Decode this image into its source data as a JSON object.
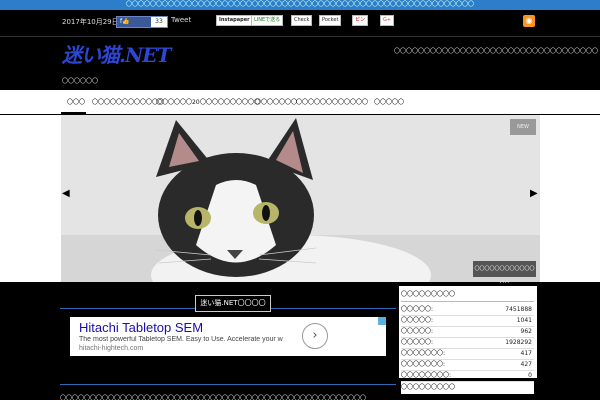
{
  "top_notice": {
    "first": "〇〇〇〇〇〇〇〇〇〇〇〇〇〇〇〇〇〇〇〇〇〇",
    "second": "〇〇〇〇〇〇〇〇〇〇〇〇〇〇〇〇〇〇〇〇〇〇〇〇〇〇〇〇〇〇〇〇〇〇〇〇"
  },
  "social": {
    "date": "2017年10月29日",
    "facebook_label": "f👍",
    "facebook_count": "33",
    "tweet_label": "Tweet",
    "buttons": [
      "Instapaper",
      "LINEで送る",
      "Check",
      "Pocket",
      "ピン",
      "G+"
    ]
  },
  "header": {
    "logo": "迷い猫.NET",
    "tagline": "〇〇〇〇〇〇",
    "right_text": "〇〇〇〇〇〇〇〇〇〇〇〇〇〇〇〇〇〇〇〇〇〇〇〇〇〇〇〇〇〇〇〇〇〇"
  },
  "nav": {
    "items": [
      "〇〇〇",
      "〇〇〇〇〇〇〇〇〇〇〇〇",
      "〇〇〇〇〇〇20",
      "〇〇〇〇〇〇〇〇〇〇",
      "〇〇〇〇〇〇〇",
      "〇〇〇〇〇〇〇",
      "〇〇〇〇〇",
      "〇〇〇〇〇"
    ]
  },
  "hero": {
    "tag": "NEW",
    "caption": "〇〇〇〇〇〇〇〇〇〇〇〇〇〇",
    "prev_arrow": "◀",
    "next_arrow": "▶"
  },
  "main": {
    "section_title": "迷い猫.NET〇〇〇〇",
    "bottom_text": "〇〇〇〇〇〇〇〇〇〇〇〇〇〇〇〇〇〇〇〇〇〇〇〇〇〇〇〇〇〇〇〇〇〇〇〇〇〇〇〇〇〇〇〇〇〇〇〇〇〇〇"
  },
  "ad": {
    "title": "Hitachi Tabletop SEM",
    "subtitle": "The most powerful Tabletop SEM. Easy to Use. Accelerate your w",
    "url": "hitachi-hightech.com",
    "button": "›"
  },
  "sidebar": {
    "heading": "〇〇〇〇〇〇〇〇〇",
    "stats": [
      {
        "label": "〇〇〇〇〇:",
        "value": "7451888"
      },
      {
        "label": "〇〇〇〇〇:",
        "value": "1041"
      },
      {
        "label": "〇〇〇〇〇:",
        "value": "962"
      },
      {
        "label": "〇〇〇〇〇:",
        "value": "1928292"
      },
      {
        "label": "〇〇〇〇〇〇〇:",
        "value": "417"
      },
      {
        "label": "〇〇〇〇〇〇〇:",
        "value": "427"
      },
      {
        "label": "〇〇〇〇〇〇〇〇:",
        "value": "0"
      }
    ],
    "heading2": "〇〇〇〇〇〇〇〇〇"
  },
  "colors": {
    "logo": "#2d46d4",
    "accent_blue": "#2c7ec9",
    "rss": "#f79422"
  }
}
